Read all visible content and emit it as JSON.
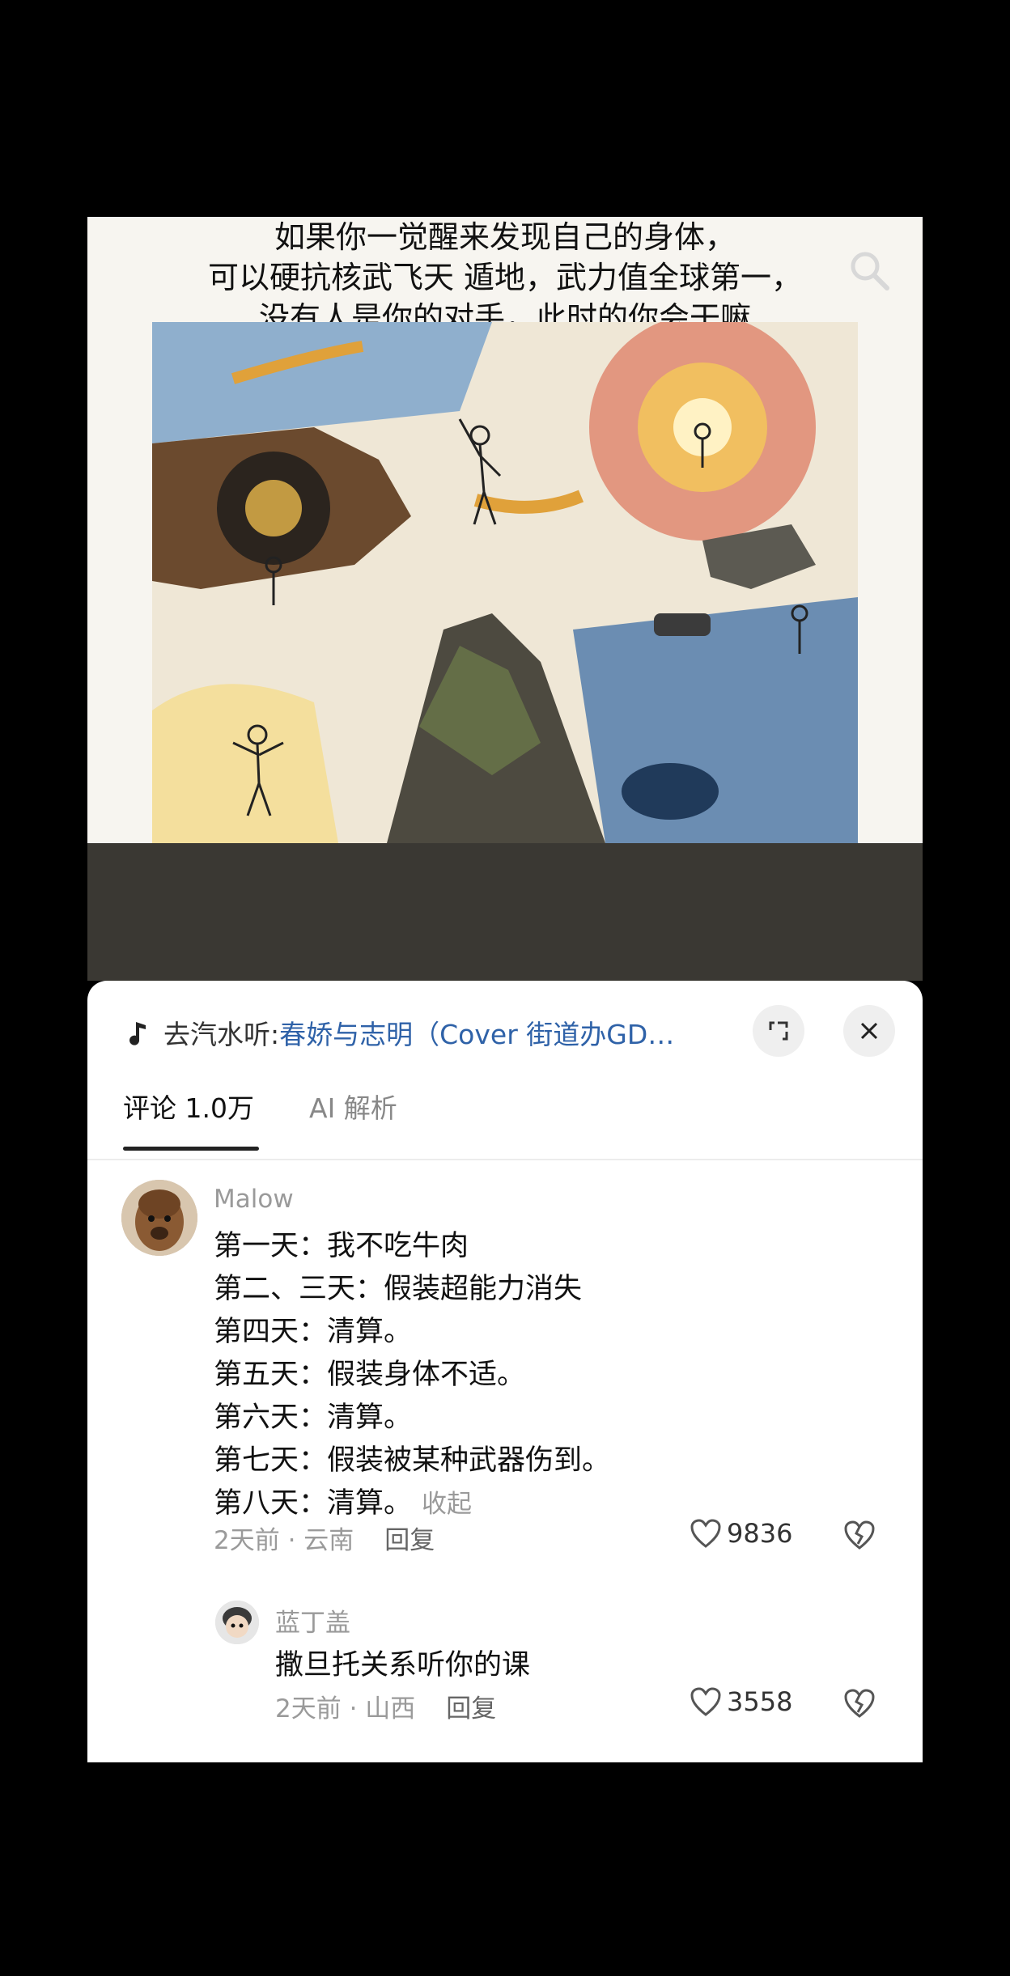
{
  "hero": {
    "caption_lines": [
      "如果你一觉醒来发现自己的身体，",
      "可以硬抗核武飞天 遁地，武力值全球第一，",
      "没有人是你的对手，此时的你会干嘛"
    ]
  },
  "music_bar": {
    "prefix": "去汽水听: ",
    "song": "春娇与志明（Cover 街道办GD…"
  },
  "tabs": [
    {
      "label": "评论 1.0万",
      "active": true
    },
    {
      "label": "AI 解析",
      "active": false
    }
  ],
  "comments": [
    {
      "user": "Malow",
      "lines": [
        "第一天：我不吃牛肉",
        "第二、三天：假装超能力消失",
        "第四天：清算。",
        "第五天：假装身体不适。",
        "第六天：清算。",
        "第七天：假装被某种武器伤到。",
        "第八天：清算。"
      ],
      "collapse_label": "收起",
      "time_location": "2天前 · 云南",
      "reply_label": "回复",
      "likes": "9836"
    },
    {
      "user": "蓝丁盖",
      "lines": [
        "撒旦托关系听你的课"
      ],
      "time_location": "2天前 · 山西",
      "reply_label": "回复",
      "likes": "3558"
    }
  ],
  "colors": {
    "link_blue": "#2f62a8",
    "muted": "#9a9a9a",
    "dark_band": "#3a3833"
  }
}
